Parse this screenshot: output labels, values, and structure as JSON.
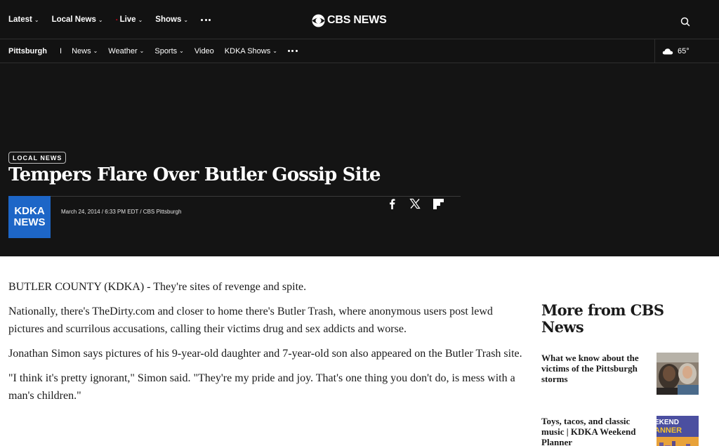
{
  "top_nav": {
    "items": [
      {
        "label": "Latest",
        "has_dropdown": true
      },
      {
        "label": "Local News",
        "has_dropdown": true
      },
      {
        "label": "Live",
        "has_dropdown": true,
        "live_indicator": true
      },
      {
        "label": "Shows",
        "has_dropdown": true
      }
    ],
    "more_icon": "more-dots-icon",
    "logo_text": "CBS NEWS",
    "search_icon": "search-icon"
  },
  "sub_nav": {
    "station": "Pittsburgh",
    "separator": "I",
    "items": [
      {
        "label": "News",
        "has_dropdown": true
      },
      {
        "label": "Weather",
        "has_dropdown": true
      },
      {
        "label": "Sports",
        "has_dropdown": true
      },
      {
        "label": "Video",
        "has_dropdown": false
      },
      {
        "label": "KDKA Shows",
        "has_dropdown": true
      }
    ],
    "more_icon": "more-dots-icon",
    "weather": {
      "icon": "cloud-icon",
      "temp": "65°"
    }
  },
  "hero": {
    "badge": "LOCAL NEWS",
    "headline": "Tempers Flare Over Butler Gossip Site",
    "station_logo": {
      "line1": "KDKA",
      "line2": "NEWS",
      "color": "#1d66c7"
    },
    "byline": "March 24, 2014 / 6:33 PM EDT / CBS Pittsburgh",
    "share_icons": [
      "facebook-icon",
      "x-icon",
      "flipboard-icon"
    ]
  },
  "article": {
    "paragraphs": [
      "BUTLER COUNTY (KDKA) - They're sites of revenge and spite.",
      "Nationally, there's TheDirty.com and closer to home there's Butler Trash, where anonymous users post lewd pictures and scurrilous accusations, calling their victims drug and sex addicts and worse.",
      "Jonathan Simon says pictures of his 9-year-old daughter and 7-year-old son also appeared on the Butler Trash site.",
      "\"I think it's pretty ignorant,\" Simon said. \"They're my pride and joy. That's one thing you don't do, is mess with a man's children.\""
    ]
  },
  "sidebar": {
    "title": "More from CBS News",
    "stories": [
      {
        "title": "What we know about the victims of the Pittsburgh storms",
        "thumb_text": ""
      },
      {
        "title": "Toys, tacos, and classic music | KDKA Weekend Planner",
        "thumb_text": "EKEND ANNER"
      }
    ]
  },
  "colors": {
    "header_bg": "#121212",
    "hero_bg": "#141414",
    "kdka_blue": "#1d66c7",
    "live_red": "#d0021b"
  }
}
